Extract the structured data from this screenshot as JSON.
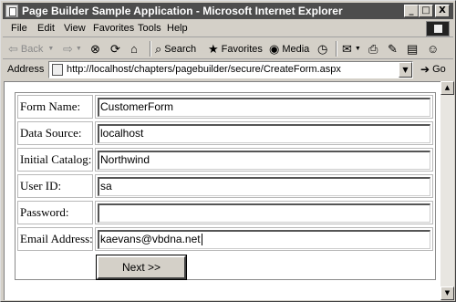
{
  "window": {
    "title": "Page Builder Sample Application - Microsoft Internet Explorer"
  },
  "titlebar_buttons": {
    "minimize": "_",
    "maximize": "□",
    "close": "X"
  },
  "menu": [
    {
      "label": "File"
    },
    {
      "label": "Edit"
    },
    {
      "label": "View"
    },
    {
      "label": "Favorites"
    },
    {
      "label": "Tools"
    },
    {
      "label": "Help"
    }
  ],
  "toolbar": {
    "back": "Back",
    "search": "Search",
    "favorites": "Favorites",
    "media": "Media"
  },
  "address": {
    "label": "Address",
    "url": "http://localhost/chapters/pagebuilder/secure/CreateForm.aspx",
    "go": "Go"
  },
  "form": {
    "fields": [
      {
        "label": "Form Name:",
        "value": "CustomerForm"
      },
      {
        "label": "Data Source:",
        "value": "localhost"
      },
      {
        "label": "Initial Catalog:",
        "value": "Northwind"
      },
      {
        "label": "User ID:",
        "value": "sa"
      },
      {
        "label": "Password:",
        "value": ""
      },
      {
        "label": "Email Address:",
        "value": "kaevans@vbdna.net"
      }
    ],
    "submit_label": "Next >>"
  }
}
